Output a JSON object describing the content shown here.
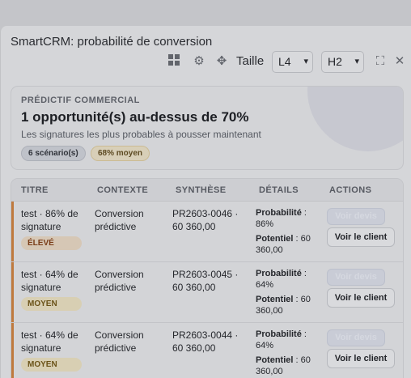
{
  "window": {
    "title": "SmartCRM: probabilité de conversion"
  },
  "toolbar": {
    "size_label": "Taille",
    "size_select": "L4",
    "height_select": "H2",
    "icons": [
      "grid-icon",
      "gear-icon",
      "move-icon",
      "expand-icon",
      "close-icon"
    ]
  },
  "summary": {
    "kicker": "PRÉDICTIF COMMERCIAL",
    "headline": "1 opportunité(s) au-dessus de 70%",
    "subtitle": "Les signatures les plus probables à pousser maintenant",
    "pill_scenarios": "6 scénario(s)",
    "pill_average": "68% moyen"
  },
  "table": {
    "columns": [
      "TITRE",
      "CONTEXTE",
      "SYNTHÈSE",
      "DÉTAILS",
      "ACTIONS"
    ],
    "rows": [
      {
        "title": "test · 86% de signature",
        "badge": "ÉLEVÉ",
        "context": "Conversion prédictive",
        "synthesis": "PR2603-0046 · 60 360,00",
        "prob_label": "Probabilité",
        "prob_value": " : 86%",
        "pot_label": "Potentiel",
        "pot_value": " : 60 360,00",
        "btn_ghost": "Voir devis",
        "btn_client": "Voir le client"
      },
      {
        "title": "test · 64% de signature",
        "badge": "MOYEN",
        "context": "Conversion prédictive",
        "synthesis": "PR2603-0045 · 60 360,00",
        "prob_label": "Probabilité",
        "prob_value": " : 64%",
        "pot_label": "Potentiel",
        "pot_value": " : 60 360,00",
        "btn_ghost": "Voir devis",
        "btn_client": "Voir le client"
      },
      {
        "title": "test · 64% de signature",
        "badge": "MOYEN",
        "context": "Conversion prédictive",
        "synthesis": "PR2603-0044 · 60 360,00",
        "prob_label": "Probabilité",
        "prob_value": " : 64%",
        "pot_label": "Potentiel",
        "pot_value": " : 60 360,00",
        "btn_ghost": "Voir devis",
        "btn_client": "Voir le client"
      }
    ]
  }
}
